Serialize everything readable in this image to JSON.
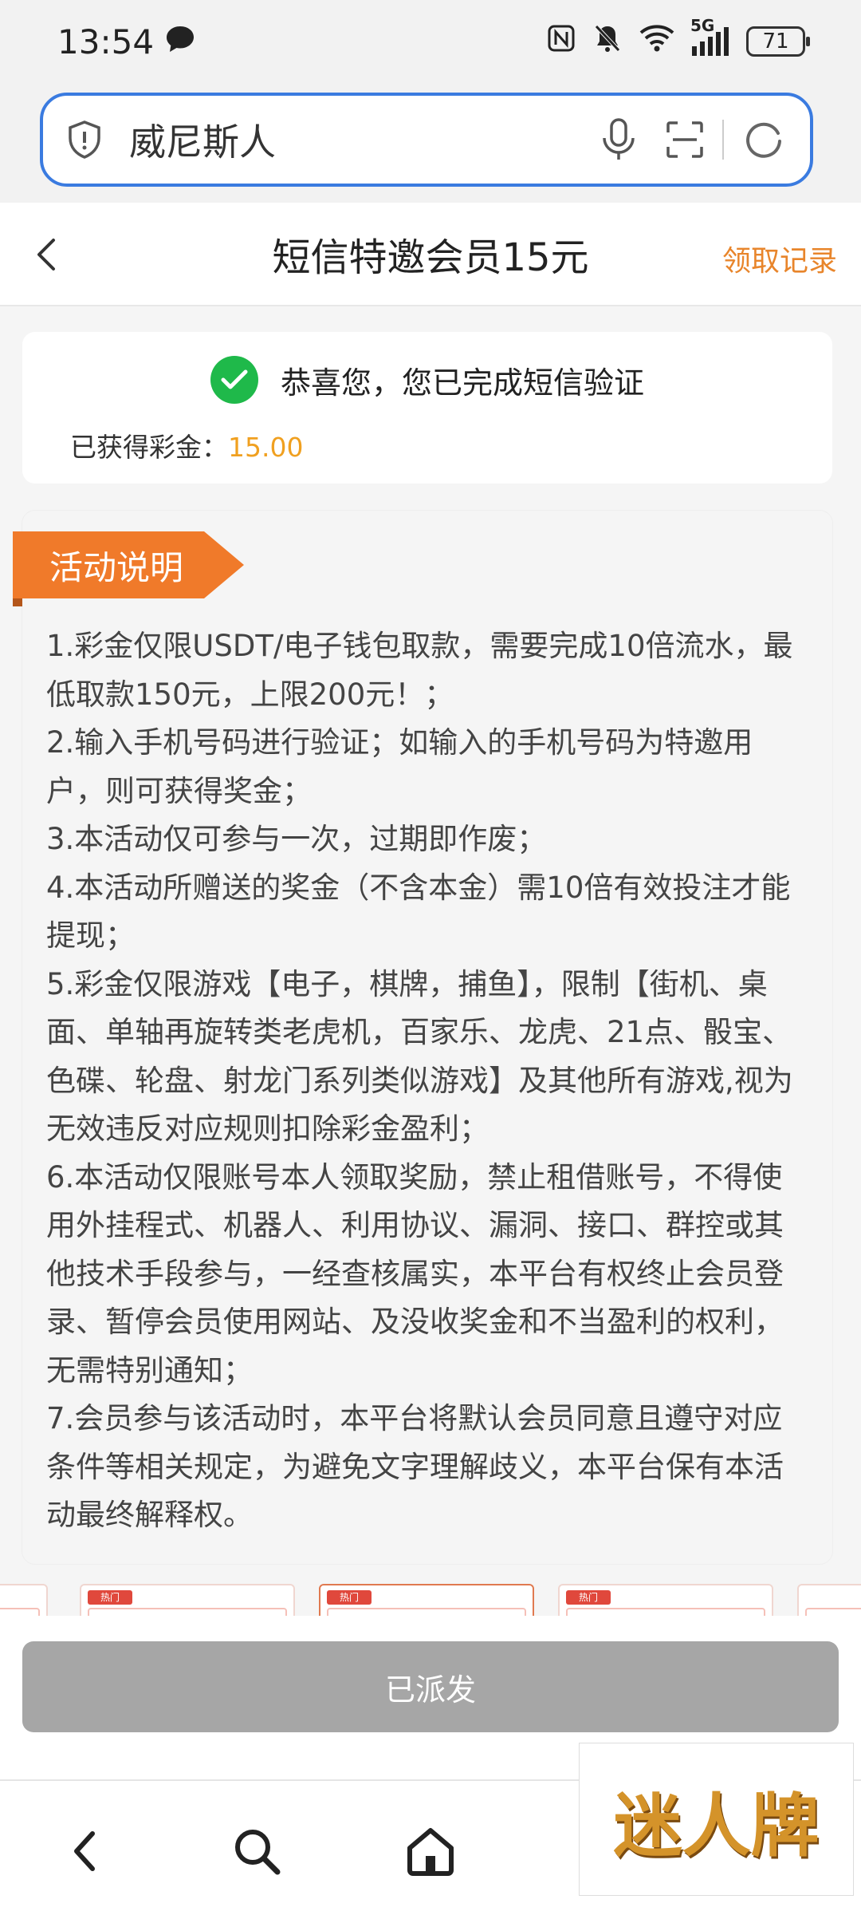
{
  "status_bar": {
    "time": "13:54",
    "network": "5G",
    "battery": "71"
  },
  "browser": {
    "search_text": "威尼斯人"
  },
  "header": {
    "title": "短信特邀会员15元",
    "records_link": "领取记录"
  },
  "success": {
    "message": "恭喜您，您已完成短信验证",
    "bonus_label": "已获得彩金：",
    "bonus_value": "15.00"
  },
  "activity": {
    "tag": "活动说明",
    "rules": [
      "1.彩金仅限USDT/电子钱包取款，需要完成10倍流水，最低取款150元，上限200元！；",
      "2.输入手机号码进行验证；如输入的手机号码为特邀用户，则可获得奖金；",
      "3.本活动仅可参与一次，过期即作废；",
      "4.本活动所赠送的奖金（不含本金）需10倍有效投注才能提现；",
      "5.彩金仅限游戏【电子，棋牌，捕鱼】，限制【街机、桌面、单轴再旋转类老虎机，百家乐、龙虎、21点、骰宝、色碟、轮盘、射龙门系列类似游戏】及其他所有游戏,视为无效违反对应规则扣除彩金盈利；",
      "6.本活动仅限账号本人领取奖励，禁止租借账号，不得使用外挂程式、机器人、利用协议、漏洞、接口、群控或其他技术手段参与，一经查核属实，本平台有权终止会员登录、暂停会员使用网站、及没收奖金和不当盈利的权利，无需特别通知；",
      "7.会员参与该活动时，本平台将默认会员同意且遵守对应条件等相关规定，为避免文字理解歧义，本平台保有本活动最终解释权。"
    ]
  },
  "thumbnails": {
    "badge": "热门"
  },
  "action": {
    "dispatch_label": "已派发"
  },
  "watermark": {
    "text": "迷人牌"
  },
  "colors": {
    "accent_orange": "#f07a2a",
    "link_orange": "#e8852b",
    "bonus_gold": "#f0a020",
    "success_green": "#1fb94a",
    "search_border_blue": "#3a7be0",
    "disabled_button": "#a6a6a6"
  }
}
